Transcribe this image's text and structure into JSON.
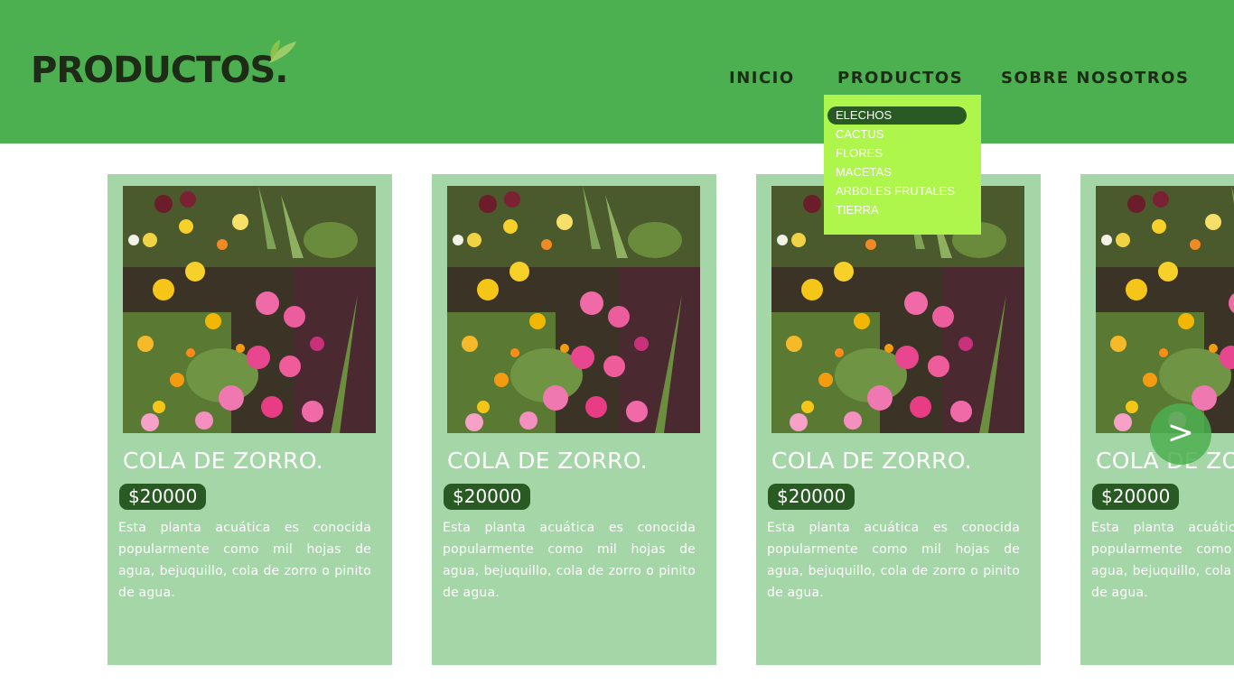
{
  "header": {
    "logo_text": "PRODUCTOS.",
    "bg_color": "#4caf50"
  },
  "nav": {
    "inicio": "INICIO",
    "productos": "PRODUCTOS",
    "sobre": "SOBRE NOSOTROS"
  },
  "dropdown": {
    "bg_color": "#aef54c",
    "items": [
      "ELECHOS",
      "CACTUS",
      "FLORES",
      "MACETAS",
      "ARBOLES FRUTALES",
      "TIERRA"
    ],
    "active_index": 0
  },
  "products": [
    {
      "title": "COLA DE ZORRO.",
      "price": "$20000",
      "description": "Esta planta acuática es conocida popularmente como mil hojas de agua, bejuquillo, cola de zorro o pinito de agua."
    },
    {
      "title": "COLA DE ZORRO.",
      "price": "$20000",
      "description": "Esta planta acuática es conocida popularmente como mil hojas de agua, bejuquillo, cola de zorro o pinito de agua."
    },
    {
      "title": "COLA DE ZORRO.",
      "price": "$20000",
      "description": "Esta planta acuática es conocida popularmente como mil hojas de agua, bejuquillo, cola de zorro o pinito de agua."
    },
    {
      "title": "COLA DE ZORRO.",
      "price": "$20000",
      "description": "Esta planta acuática es conocida popularmente como mil hojas de agua, bejuquillo, cola de zorro o pinito de agua."
    }
  ],
  "carousel": {
    "next_label": ">"
  },
  "colors": {
    "card_bg": "#a5d6a7",
    "price_bg": "#2a5a24",
    "text_dark": "#1d2b17"
  }
}
